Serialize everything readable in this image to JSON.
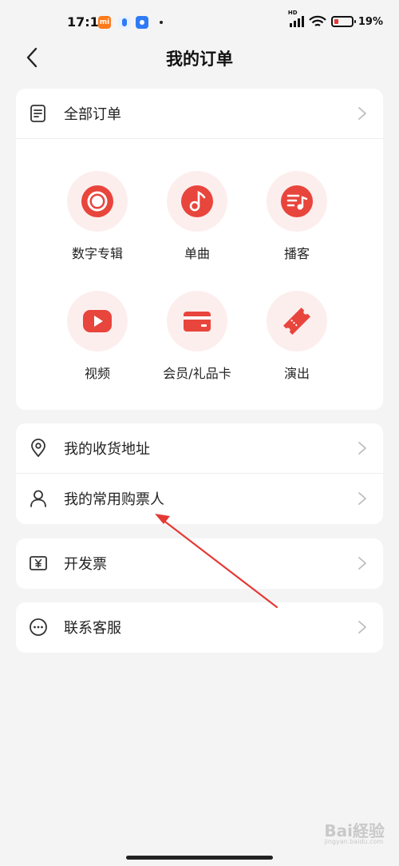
{
  "status_bar": {
    "time": "17:17",
    "mi_label": "mi",
    "battery": "19%",
    "hd": "HD"
  },
  "header": {
    "title": "我的订单",
    "back_icon": "chevron-left-icon"
  },
  "orders_card": {
    "all_orders_label": "全部订单",
    "all_orders_icon": "document-list-icon",
    "categories": [
      {
        "label": "数字专辑",
        "icon": "disc-icon"
      },
      {
        "label": "单曲",
        "icon": "music-note-icon"
      },
      {
        "label": "播客",
        "icon": "podcast-icon"
      },
      {
        "label": "视频",
        "icon": "play-video-icon"
      },
      {
        "label": "会员/礼品卡",
        "icon": "card-icon"
      },
      {
        "label": "演出",
        "icon": "ticket-icon"
      }
    ]
  },
  "address_card": {
    "items": [
      {
        "label": "我的收货地址",
        "icon": "location-pin-icon"
      },
      {
        "label": "我的常用购票人",
        "icon": "person-icon"
      }
    ]
  },
  "invoice": {
    "label": "开发票",
    "icon": "yen-receipt-icon"
  },
  "service": {
    "label": "联系客服",
    "icon": "chat-dots-icon"
  },
  "colors": {
    "accent": "#e8453c",
    "accent_light": "#fdeeee",
    "background": "#f4f4f5",
    "annotation_arrow": "#e53935"
  },
  "watermark": {
    "text": "Bai経验",
    "sub": "jingyan.baidu.com"
  }
}
